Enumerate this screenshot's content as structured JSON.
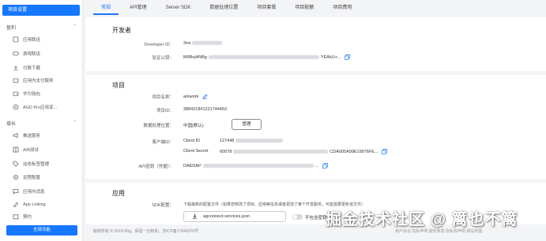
{
  "sidebar": {
    "active": "项目设置",
    "groups": [
      {
        "label": "盈利",
        "items": [
          "应用联运",
          "游戏联运",
          "付费下载",
          "应用内支付服务",
          "华为钱包",
          "AGD Pro应用变..."
        ]
      },
      {
        "label": "增长",
        "items": [
          "推送服务",
          "A/B测试",
          "动态标签管理",
          "远程配置",
          "应用内消息",
          "App Linking",
          "预约"
        ]
      }
    ],
    "bottom_button": "全部功能"
  },
  "tabs": [
    "常规",
    "API管理",
    "Server SDK",
    "数据处理位置",
    "项目套餐",
    "项目配额",
    "项目费用"
  ],
  "developer": {
    "title": "开发者",
    "developer_id_label": "Developer ID：",
    "developer_id_value": "2ea",
    "public_key_label": "验证公钥：",
    "public_key_value_start": "MIIBojANBg",
    "public_key_value_end": "YEAkU+..."
  },
  "project": {
    "title": "项目",
    "name_label": "项目名称：",
    "name_value": "arkwork",
    "id_label": "项目ID：",
    "id_value": "388421841221744453",
    "location_label": "数据处理位置：",
    "location_value": "中国(默认)",
    "manage_button": "管理",
    "client_label": "客户端ID：",
    "client_id_label": "Client ID",
    "client_id_value": "127448",
    "client_secret_label": "Client Secret",
    "client_secret_start": "60078",
    "client_secret_end": "CDA005A99E19976FE...",
    "api_key_label": "API密钥（凭据）：",
    "api_key_start": "DAEDAP",
    "api_key_end": "..."
  },
  "app": {
    "title": "应用",
    "sdk_label": "SDK配置：",
    "sdk_desc": "下载最新的配置文件（如果您修改了项目、应用等信息或者更改了某个开发服务，可能需要更新该文件）",
    "download_button": "agconnect-services.json",
    "toggle_label": "不包含密钥"
  },
  "footer": {
    "left": "版权所有 © 2019-90g。保留一切权利。苏ICP备17040376号",
    "right": "用户协议 隐私声明 服务条款 隐私权声明 网站地图"
  },
  "watermark": "掘金技术社区 @ 篱也不篱",
  "colors": {
    "accent": "#1677ff"
  }
}
